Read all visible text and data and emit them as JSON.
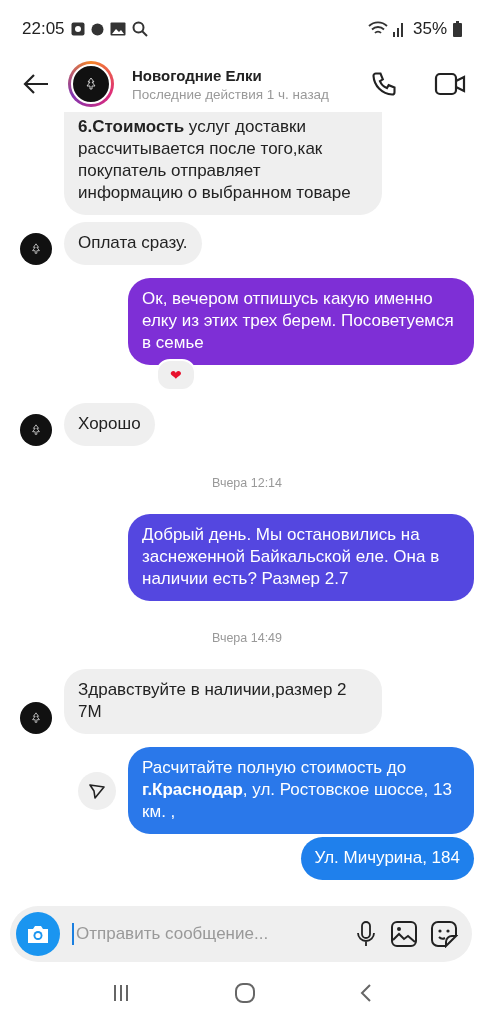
{
  "status_bar": {
    "time": "22:05",
    "battery": "35%"
  },
  "header": {
    "title": "Новогодние Елки",
    "subtitle": "Последние действия 1 ч. назад"
  },
  "messages": [
    {
      "kind": "received",
      "text": "**6.Стоимость** услуг доставки рассчитывается после того,как покупатель отправляет информацию о выбранном товаре",
      "cut_top": true,
      "avatar": false
    },
    {
      "kind": "received",
      "text": "Оплата сразу.",
      "avatar": true
    },
    {
      "kind": "sent",
      "text": "Ок, вечером отпишусь какую именно елку из этих трех берем. Посоветуемся в семье",
      "color": "#7e2fd6",
      "reaction": "❤"
    },
    {
      "kind": "received",
      "text": "Хорошо",
      "avatar": true
    },
    {
      "kind": "timestamp",
      "text": "Вчера 12:14"
    },
    {
      "kind": "sent",
      "text": "Добрый день. Мы остановились на заснеженной Байкальской еле. Она в наличии есть? Размер 2.7",
      "color": "#5447e0"
    },
    {
      "kind": "timestamp",
      "text": "Вчера 14:49"
    },
    {
      "kind": "received",
      "text": "Здравствуйте в наличии,размер 2 7М",
      "avatar": true
    },
    {
      "kind": "sent",
      "text": "Расчитайте полную стоимость до **г.Краснодар**, ул. Ростовское шоссе, 13 км. ,",
      "color": "#2a78ea",
      "share": true
    },
    {
      "kind": "sent",
      "text": "Ул. Мичурина, 184",
      "color": "#1f80ec"
    }
  ],
  "composer": {
    "placeholder": "Отправить сообщение..."
  }
}
